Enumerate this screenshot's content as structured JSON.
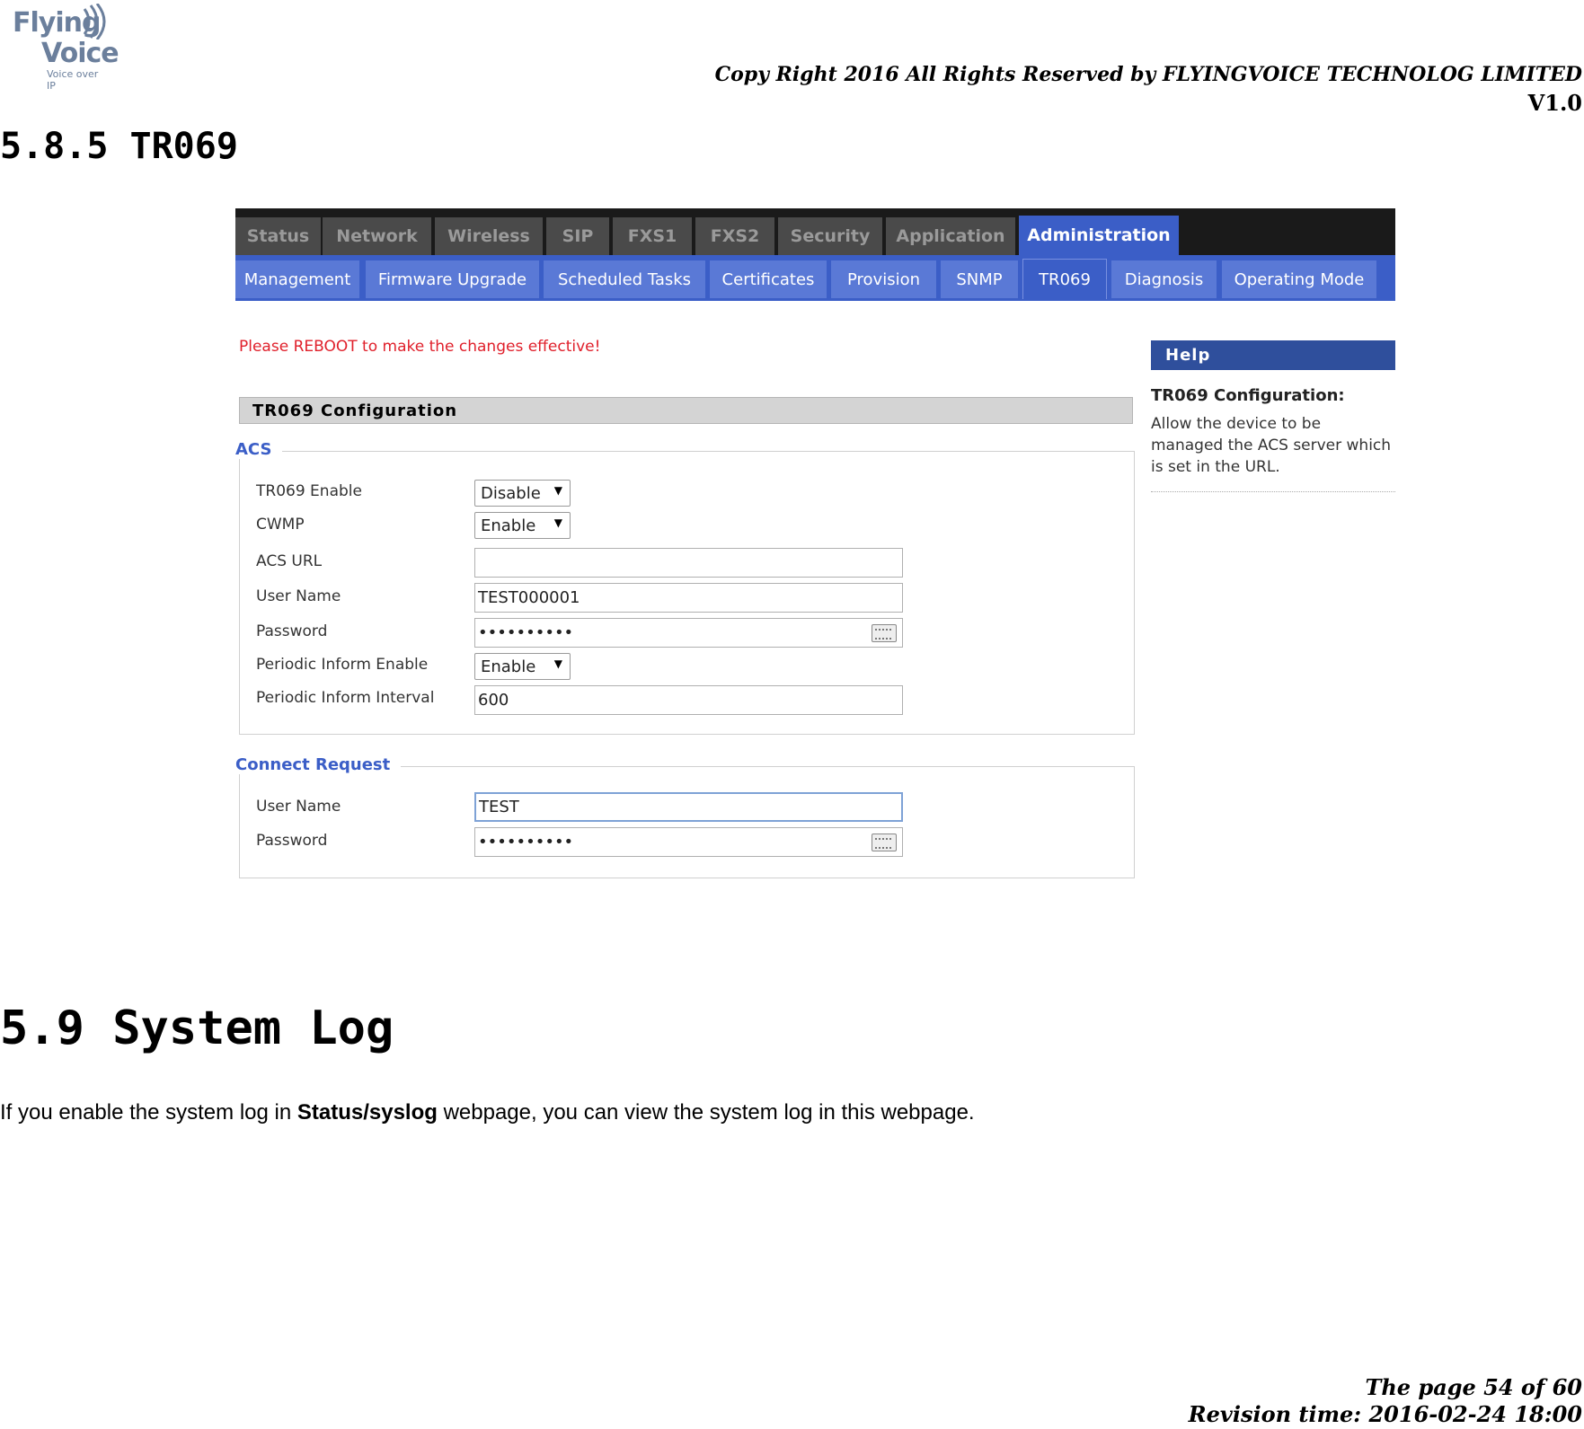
{
  "header": {
    "logo_line1": "Flying",
    "logo_line2": "Voice",
    "logo_line3": "Voice over IP",
    "copyright": "Copy Right 2016 All Rights Reserved by FLYINGVOICE TECHNOLOG LIMITED",
    "version": "V1.0"
  },
  "section_tr069": {
    "heading": "5.8.5 TR069"
  },
  "ui": {
    "top_tabs": [
      {
        "label": "Status"
      },
      {
        "label": "Network"
      },
      {
        "label": "Wireless"
      },
      {
        "label": "SIP"
      },
      {
        "label": "FXS1"
      },
      {
        "label": "FXS2"
      },
      {
        "label": "Security"
      },
      {
        "label": "Application"
      },
      {
        "label": "Administration"
      }
    ],
    "sub_tabs": [
      {
        "label": "Management"
      },
      {
        "label": "Firmware Upgrade"
      },
      {
        "label": "Scheduled Tasks"
      },
      {
        "label": "Certificates"
      },
      {
        "label": "Provision"
      },
      {
        "label": "SNMP"
      },
      {
        "label": "TR069"
      },
      {
        "label": "Diagnosis"
      },
      {
        "label": "Operating Mode"
      }
    ],
    "reboot_notice": "Please REBOOT to make the changes effective!",
    "config_title": "TR069 Configuration",
    "acs": {
      "legend": "ACS",
      "tr069_enable_label": "TR069 Enable",
      "tr069_enable_value": "Disable",
      "cwmp_label": "CWMP",
      "cwmp_value": "Enable",
      "acs_url_label": "ACS URL",
      "acs_url_value": "",
      "username_label": "User Name",
      "username_value": "TEST000001",
      "password_label": "Password",
      "password_value": "••••••••••",
      "periodic_enable_label": "Periodic Inform Enable",
      "periodic_enable_value": "Enable",
      "periodic_interval_label": "Periodic Inform Interval",
      "periodic_interval_value": "600"
    },
    "connect_request": {
      "legend": "Connect Request",
      "username_label": "User Name",
      "username_value": "TEST",
      "password_label": "Password",
      "password_value": "••••••••••"
    },
    "help": {
      "heading": "Help",
      "title": "TR069 Configuration:",
      "text": "Allow the device to be managed the ACS server which is set in the URL."
    }
  },
  "section_syslog": {
    "heading": "5.9 System Log",
    "para_before": "If you enable the system log in ",
    "para_bold": "Status/syslog",
    "para_after": " webpage, you can view the system log in this webpage."
  },
  "footer": {
    "page": "The page 54 of 60",
    "revision": "Revision time: 2016-02-24 18:00"
  }
}
